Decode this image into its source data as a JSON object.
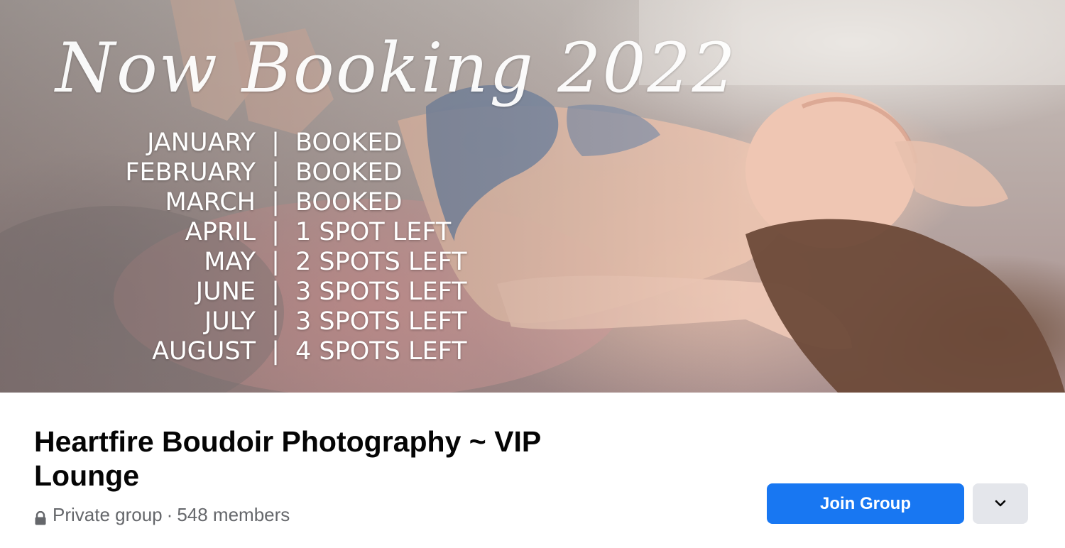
{
  "cover": {
    "title": "Now Booking 2022",
    "schedule": [
      {
        "month": "JANUARY",
        "status": "BOOKED"
      },
      {
        "month": "FEBRUARY",
        "status": "BOOKED"
      },
      {
        "month": "MARCH",
        "status": "BOOKED"
      },
      {
        "month": "APRIL",
        "status": "1 SPOT LEFT"
      },
      {
        "month": "MAY",
        "status": "2 SPOTS LEFT"
      },
      {
        "month": "JUNE",
        "status": "3 SPOTS LEFT"
      },
      {
        "month": "JULY",
        "status": "3 SPOTS LEFT"
      },
      {
        "month": "AUGUST",
        "status": "4 SPOTS LEFT"
      }
    ],
    "separator": "|"
  },
  "group": {
    "name": "Heartfire Boudoir Photography ~ VIP Lounge",
    "privacy": "Private group",
    "separator": "·",
    "members": "548 members"
  },
  "actions": {
    "join_label": "Join Group",
    "more_icon": "chevron-down-icon"
  },
  "colors": {
    "primary": "#1877f2",
    "secondary_button": "#e4e6eb",
    "meta_text": "#65676b",
    "title_text": "#050505"
  }
}
